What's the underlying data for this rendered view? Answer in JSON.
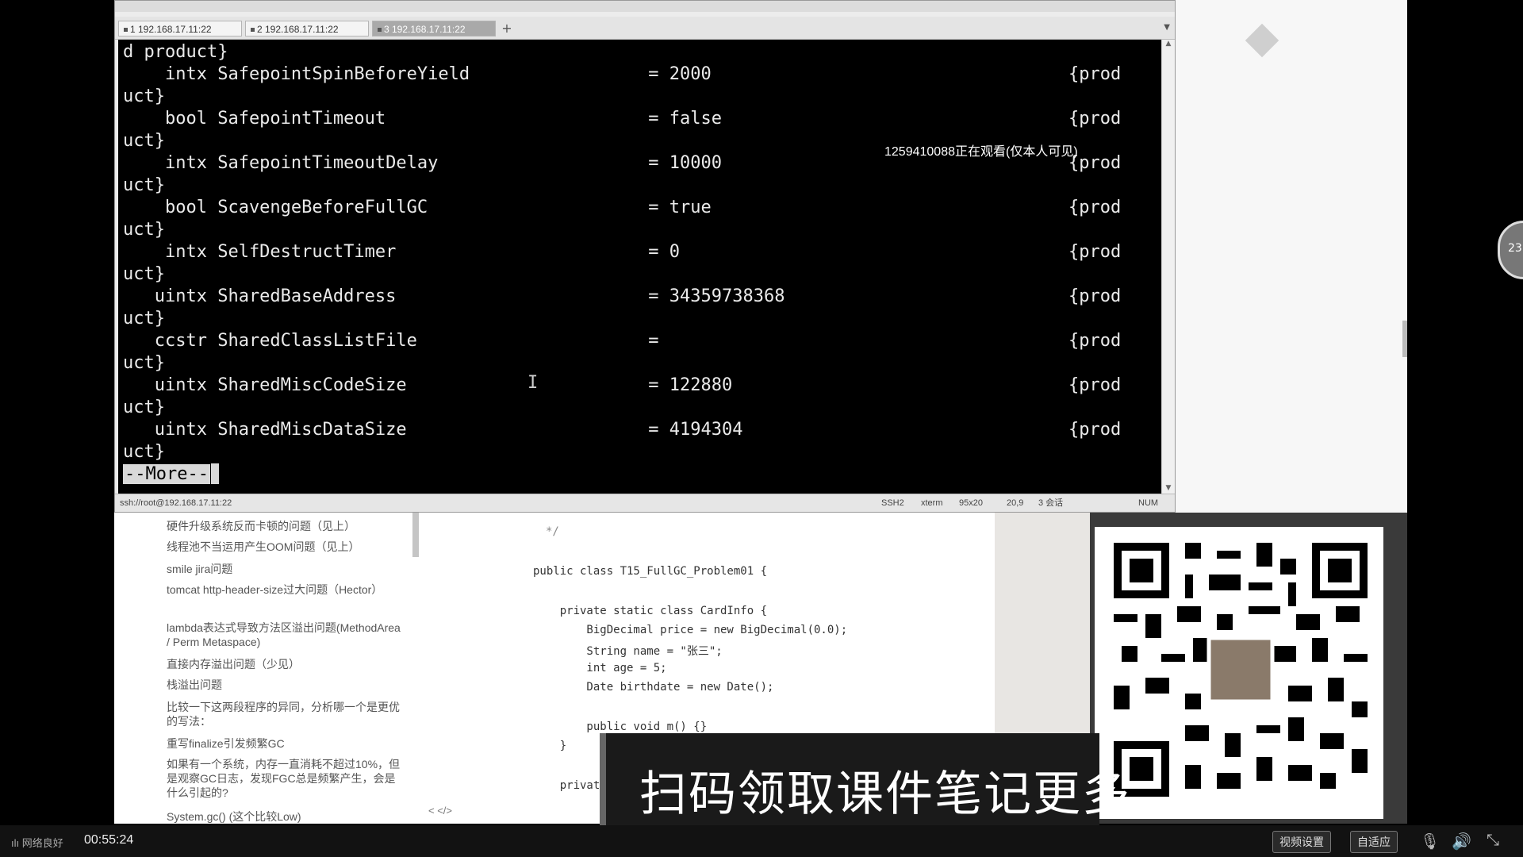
{
  "terminal": {
    "tabs": [
      {
        "label": "1 192.168.17.11:22"
      },
      {
        "label": "2 192.168.17.11:22"
      },
      {
        "label": "3 192.168.17.11:22"
      }
    ],
    "tab_add": "+",
    "lines": [
      "d product}",
      "    intx SafepointSpinBeforeYield                 = 2000                                  {prod",
      "uct}",
      "    bool SafepointTimeout                         = false                                 {prod",
      "uct}",
      "    intx SafepointTimeoutDelay                    = 10000                                 {prod",
      "uct}",
      "    bool ScavengeBeforeFullGC                     = true                                  {prod",
      "uct}",
      "    intx SelfDestructTimer                        = 0                                     {prod",
      "uct}",
      "   uintx SharedBaseAddress                        = 34359738368                           {prod",
      "uct}",
      "   ccstr SharedClassListFile                      =                                       {prod",
      "uct}",
      "   uintx SharedMiscCodeSize                       = 122880                                {prod",
      "uct}",
      "   uintx SharedMiscDataSize                       = 4194304                               {prod",
      "uct}"
    ],
    "more_prompt": "--More--",
    "viewer_notice": "1259410088正在观看(仅本人可见)",
    "status": {
      "path": "ssh://root@192.168.17.11:22",
      "protocol": "SSH2",
      "term": "xterm",
      "size": "95x20",
      "pos": "20,9",
      "sessions": "3 会话",
      "num": "NUM"
    }
  },
  "sidebar": {
    "items": [
      "硬件升级系统反而卡顿的问题（见上）",
      "线程池不当运用产生OOM问题（见上）",
      "smile jira问题",
      "tomcat http-header-size过大问题（Hector）",
      "lambda表达式导致方法区溢出问题(MethodArea / Perm Metaspace)",
      "直接内存溢出问题（少见）",
      "栈溢出问题",
      "比较一下这两段程序的异同，分析哪一个是更优的写法：",
      "重写finalize引发频繁GC",
      "如果有一个系统，内存一直消耗不超过10%，但是观察GC日志，发现FGC总是频繁产生，会是什么引起的?",
      "System.gc() (这个比较Low)"
    ]
  },
  "code": {
    "lines": [
      "*/",
      "",
      "public class T15_FullGC_Problem01 {",
      "",
      "    private static class CardInfo {",
      "        BigDecimal price = new BigDecimal(0.0);",
      "        String name = \"张三\";",
      "        int age = 5;",
      "        Date birthdate = new Date();",
      "",
      "        public void m() {}",
      "    }",
      "",
      "    private static"
    ],
    "footer_symbols": "<  </>"
  },
  "banner": {
    "text": "扫码领取课件笔记更多"
  },
  "float_badge": "23",
  "bottom": {
    "network": "网络良好",
    "time": "00:55:24",
    "video_settings": "视频设置",
    "auto_fit": "自适应"
  },
  "colors": {
    "terminal_bg": "#000000",
    "terminal_fg": "#eaeaea",
    "bottom_bar": "#121212"
  },
  "icons": [
    "mic-icon",
    "volume-icon",
    "fullscreen-icon",
    "scan-qr-icon",
    "signal-icon"
  ]
}
